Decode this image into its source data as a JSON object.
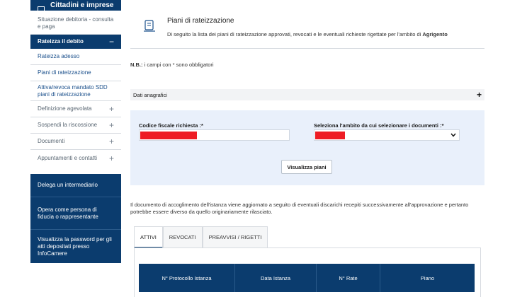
{
  "sidebar": {
    "header": "Cittadini e imprese",
    "items": [
      {
        "label": "Situazione debitoria - consulta e paga"
      },
      {
        "label": "Rateizza il debito",
        "toggle": "−"
      },
      {
        "label": "Rateizza adesso"
      },
      {
        "label": "Piani di rateizzazione"
      },
      {
        "label": "Attiva/revoca mandato SDD piani di rateizzazione"
      },
      {
        "label": "Definizione agevolata",
        "toggle": "+"
      },
      {
        "label": "Sospendi la riscossione",
        "toggle": "+"
      },
      {
        "label": "Documenti",
        "toggle": "+"
      },
      {
        "label": "Appuntamenti e contatti",
        "toggle": "+"
      }
    ],
    "blue_items": [
      {
        "label": "Delega un intermediario"
      },
      {
        "label": "Opera come persona di fiducia o rappresentante"
      },
      {
        "label": "Visualizza la password per gli atti depositati presso InfoCamere"
      }
    ]
  },
  "page": {
    "title": "Piani di rateizzazione",
    "subtitle_prefix": "Di seguito la lista dei piani di rateizzazione approvati, revocati e le eventuali richieste rigettate per l'ambito di",
    "subtitle_bold": "Agrigento"
  },
  "note": {
    "bold": "N.B.:",
    "text": "i campi con * sono obbligatori"
  },
  "dati_anagrafici": {
    "label": "Dati anagrafici",
    "toggle": "+"
  },
  "form": {
    "codice_label": "Codice fiscale richiesta :*",
    "ambito_label": "Seleziona l'ambito da cui selezionare i documenti :*",
    "submit_label": "Visualizza piani"
  },
  "info_text": "Il documento di accoglimento dell'istanza viene aggiornato a seguito di eventuali discarichi recepiti successivamente all'approvazione e pertanto potrebbe essere diverso da quello originariamente rilasciato.",
  "tabs": [
    {
      "label": "ATTIVI",
      "active": true
    },
    {
      "label": "REVOCATI",
      "active": false
    },
    {
      "label": "PREAVVISI / RIGETTI",
      "active": false
    }
  ],
  "table": {
    "columns": [
      "N° Protocollo Istanza",
      "Data Istanza",
      "N° Rate",
      "Piano"
    ]
  },
  "colors": {
    "brand": "#0b3c6e",
    "redaction": "#ee1c24",
    "form_bg": "#e9f0fb"
  }
}
